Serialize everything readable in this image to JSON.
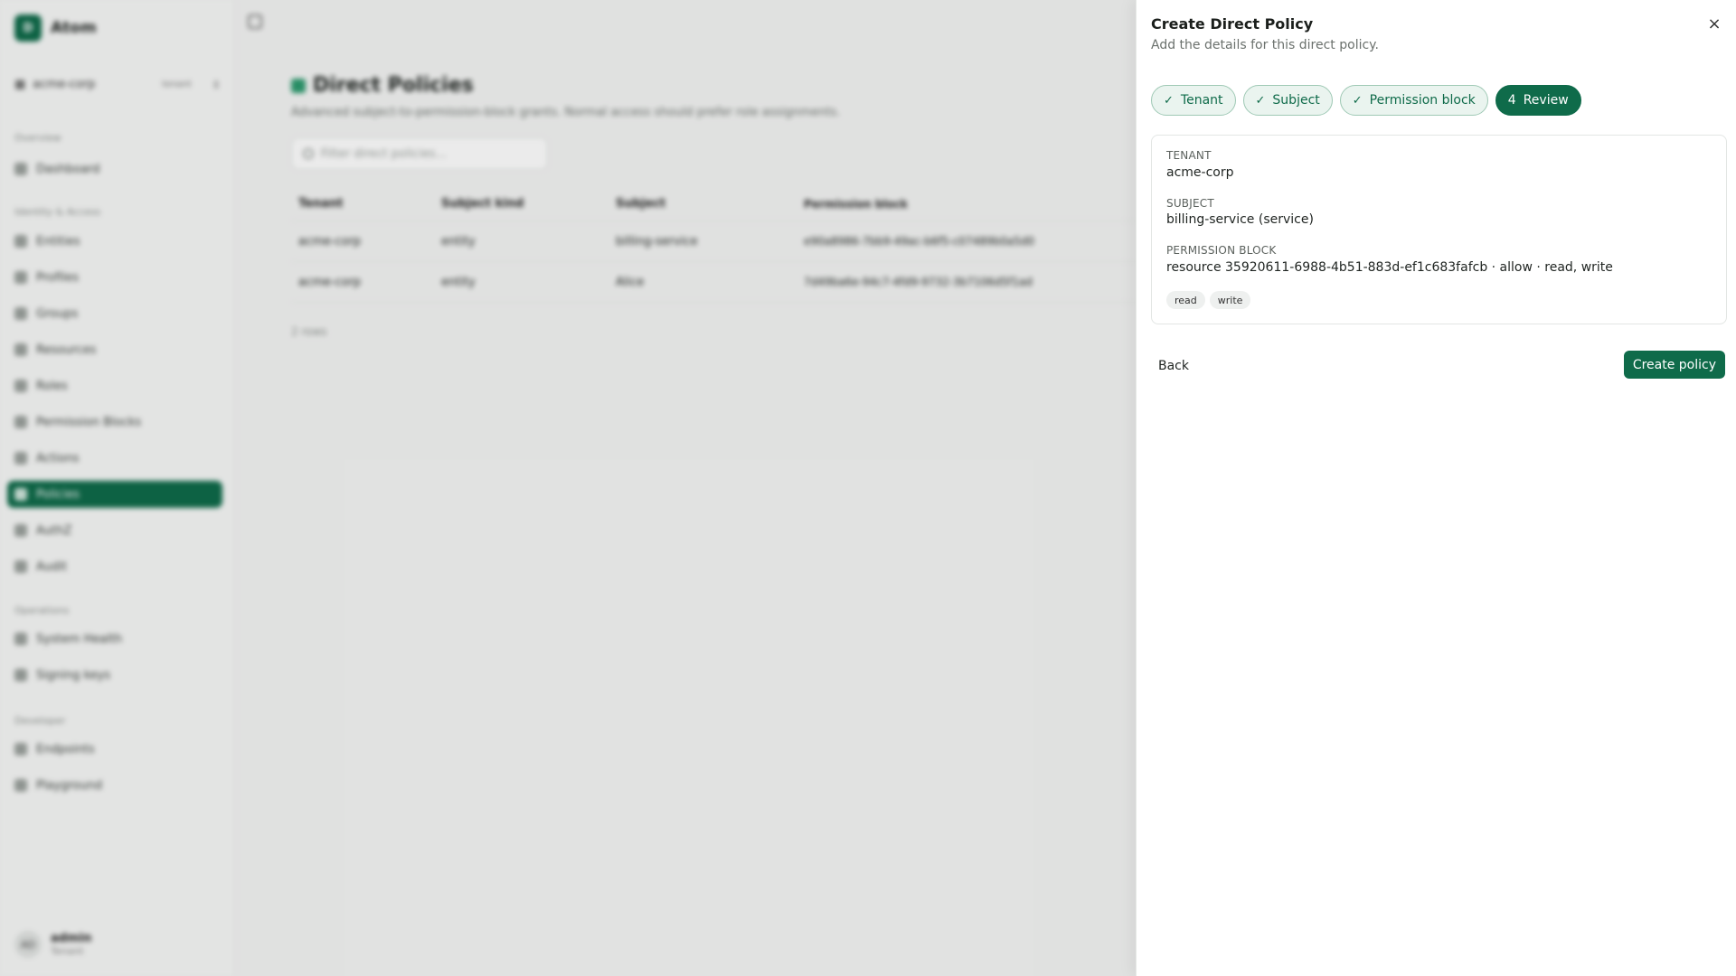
{
  "app": {
    "brand_initial": "D",
    "brand_name": "Atom",
    "tenant": "acme-corp",
    "tenant_tag": "tenant",
    "sections": {
      "overview": "Overview",
      "identity": "Identity & Access",
      "operations": "Operations",
      "developer": "Developer"
    },
    "nav": {
      "dashboard": "Dashboard",
      "entities": "Entities",
      "profiles": "Profiles",
      "groups": "Groups",
      "resources": "Resources",
      "roles": "Roles",
      "permission_blocks": "Permission Blocks",
      "actions": "Actions",
      "policies": "Policies",
      "authz": "AuthZ",
      "audit": "Audit",
      "system_health": "System Health",
      "signing_keys": "Signing keys",
      "endpoints": "Endpoints",
      "playground": "Playground"
    },
    "user": {
      "initials": "AD",
      "name": "admin",
      "role": "Tenant"
    }
  },
  "page": {
    "title": "Direct Policies",
    "description": "Advanced subject-to-permission-block grants. Normal access should prefer role assignments.",
    "filter_placeholder": "Filter direct policies...",
    "columns": [
      "Tenant",
      "Subject kind",
      "Subject",
      "Permission block"
    ],
    "rows": [
      [
        "acme-corp",
        "entity",
        "billing-service",
        "e90a8986-7bb9-49ac-b6f5-c07489b0a5d0"
      ],
      [
        "acme-corp",
        "entity",
        "Alice",
        "7d49ba6e-94c7-4fd9-9732-3b7106d5f1ad"
      ]
    ],
    "row_count": "2 rows"
  },
  "drawer": {
    "title": "Create Direct Policy",
    "subtitle": "Add the details for this direct policy.",
    "close_icon": "×",
    "steps": [
      {
        "label": "Tenant",
        "marker": "✓"
      },
      {
        "label": "Subject",
        "marker": "✓"
      },
      {
        "label": "Permission block",
        "marker": "✓"
      },
      {
        "label": "Review",
        "marker": "4"
      }
    ],
    "review": {
      "tenant_label": "TENANT",
      "tenant_value": "acme-corp",
      "subject_label": "SUBJECT",
      "subject_value": "billing-service (service)",
      "block_label": "PERMISSION BLOCK",
      "block_value": "resource 35920611-6988-4b51-883d-ef1c683fafcb · allow · read, write",
      "chips": [
        "read",
        "write"
      ]
    },
    "back_label": "Back",
    "create_label": "Create policy"
  },
  "colors": {
    "accent": "#0f6b4a",
    "step_done_bg": "#eaf4ef"
  }
}
